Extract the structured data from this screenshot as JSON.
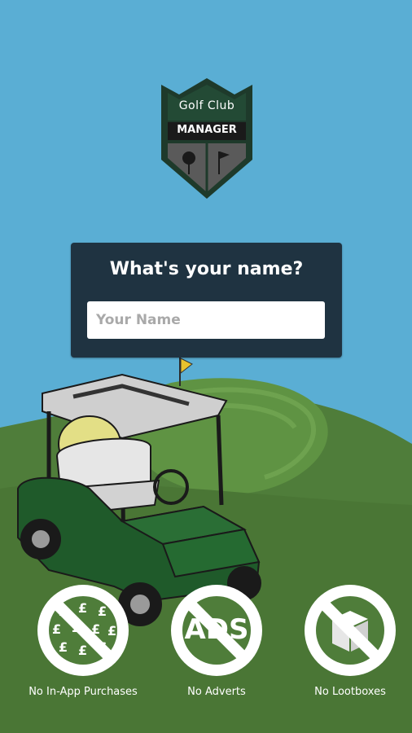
{
  "logo": {
    "line1": "Golf Club",
    "line2": "MANAGER"
  },
  "name_prompt": {
    "title": "What's your name?",
    "placeholder": "Your Name",
    "value": ""
  },
  "features": [
    {
      "label": "No In-App Purchases",
      "icon": "no-pound-icon"
    },
    {
      "label": "No Adverts",
      "icon": "no-ads-icon",
      "icon_text": "ADS"
    },
    {
      "label": "No Lootboxes",
      "icon": "no-lootbox-icon"
    }
  ],
  "colors": {
    "sky": "#5aaed4",
    "grass": "#4f7d3a",
    "card": "#1f3341",
    "cart": "#1f5a2a"
  }
}
